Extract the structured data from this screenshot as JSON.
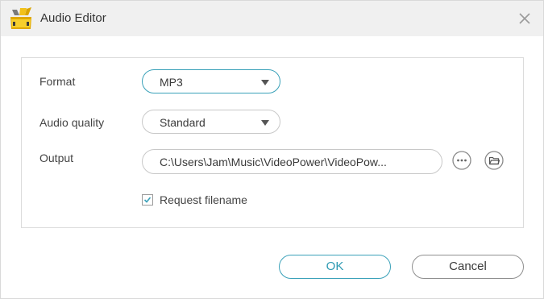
{
  "window": {
    "title": "Audio Editor",
    "logo_icon": "videopower-logo-icon",
    "close_icon": "close-icon"
  },
  "form": {
    "format": {
      "label": "Format",
      "value": "MP3"
    },
    "quality": {
      "label": "Audio quality",
      "value": "Standard"
    },
    "output": {
      "label": "Output",
      "value": "C:\\Users\\Jam\\Music\\VideoPower\\VideoPow..."
    },
    "request_filename": {
      "label": "Request filename",
      "checked": true
    }
  },
  "buttons": {
    "ok": "OK",
    "cancel": "Cancel"
  },
  "colors": {
    "accent": "#3aa1b9",
    "titlebar": "#f0f0f0",
    "logo_yellow": "#f2c11a"
  }
}
